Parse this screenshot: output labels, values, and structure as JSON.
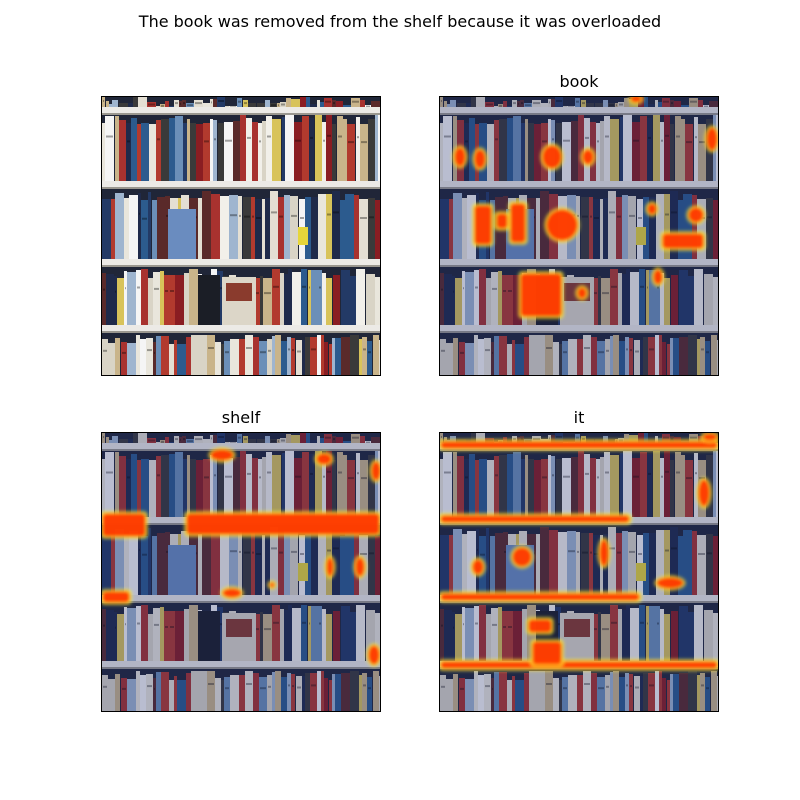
{
  "figure": {
    "suptitle": "The book was removed from the shelf because it was overloaded"
  },
  "panels": [
    {
      "title": "",
      "image": "bookshelf-photo",
      "overlay": "none"
    },
    {
      "title": "book",
      "image": "bookshelf-photo",
      "overlay": "attention-heatmap"
    },
    {
      "title": "shelf",
      "image": "bookshelf-photo",
      "overlay": "attention-heatmap"
    },
    {
      "title": "it",
      "image": "bookshelf-photo",
      "overlay": "attention-heatmap"
    }
  ],
  "colors": {
    "heat_hot": "#ff2a00",
    "heat_warm": "#ff7a00",
    "heat_edge": "#ffff33",
    "heat_cool": "#1d2a6e"
  }
}
